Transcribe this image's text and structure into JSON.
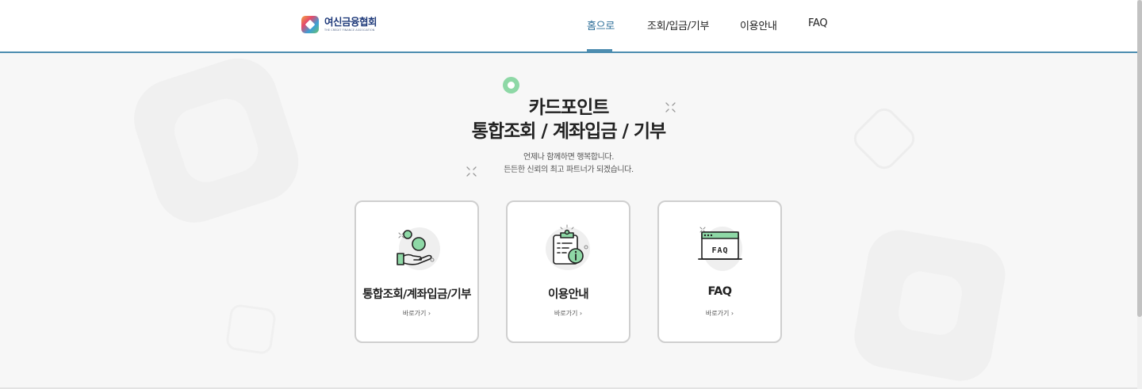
{
  "header": {
    "logo": {
      "name": "여신금융협회",
      "sub": "THE CREDIT FINANCE ASSOCIATION"
    },
    "nav": [
      {
        "label": "홈으로",
        "active": true
      },
      {
        "label": "조회/입금/기부",
        "active": false
      },
      {
        "label": "이용안내",
        "active": false
      },
      {
        "label": "FAQ",
        "active": false
      }
    ]
  },
  "hero": {
    "title_line1": "카드포인트",
    "title_line2": "통합조회 / 계좌입금 / 기부",
    "sub_line1": "언제나 함께하면 행복합니다.",
    "sub_line2": "든든한 신뢰의 최고 파트너가 되겠습니다."
  },
  "cards": [
    {
      "title": "통합조회/계좌입금/기부",
      "link": "바로가기",
      "icon": "coin-hand-icon"
    },
    {
      "title": "이용안내",
      "link": "바로가기",
      "icon": "clipboard-info-icon"
    },
    {
      "title": "FAQ",
      "link": "바로가기",
      "icon": "faq-screen-icon"
    }
  ],
  "colors": {
    "accent": "#4d8db0",
    "nav_active": "#2d6e98",
    "green": "#8ed8a6",
    "logo_navy": "#1f3a7a"
  }
}
